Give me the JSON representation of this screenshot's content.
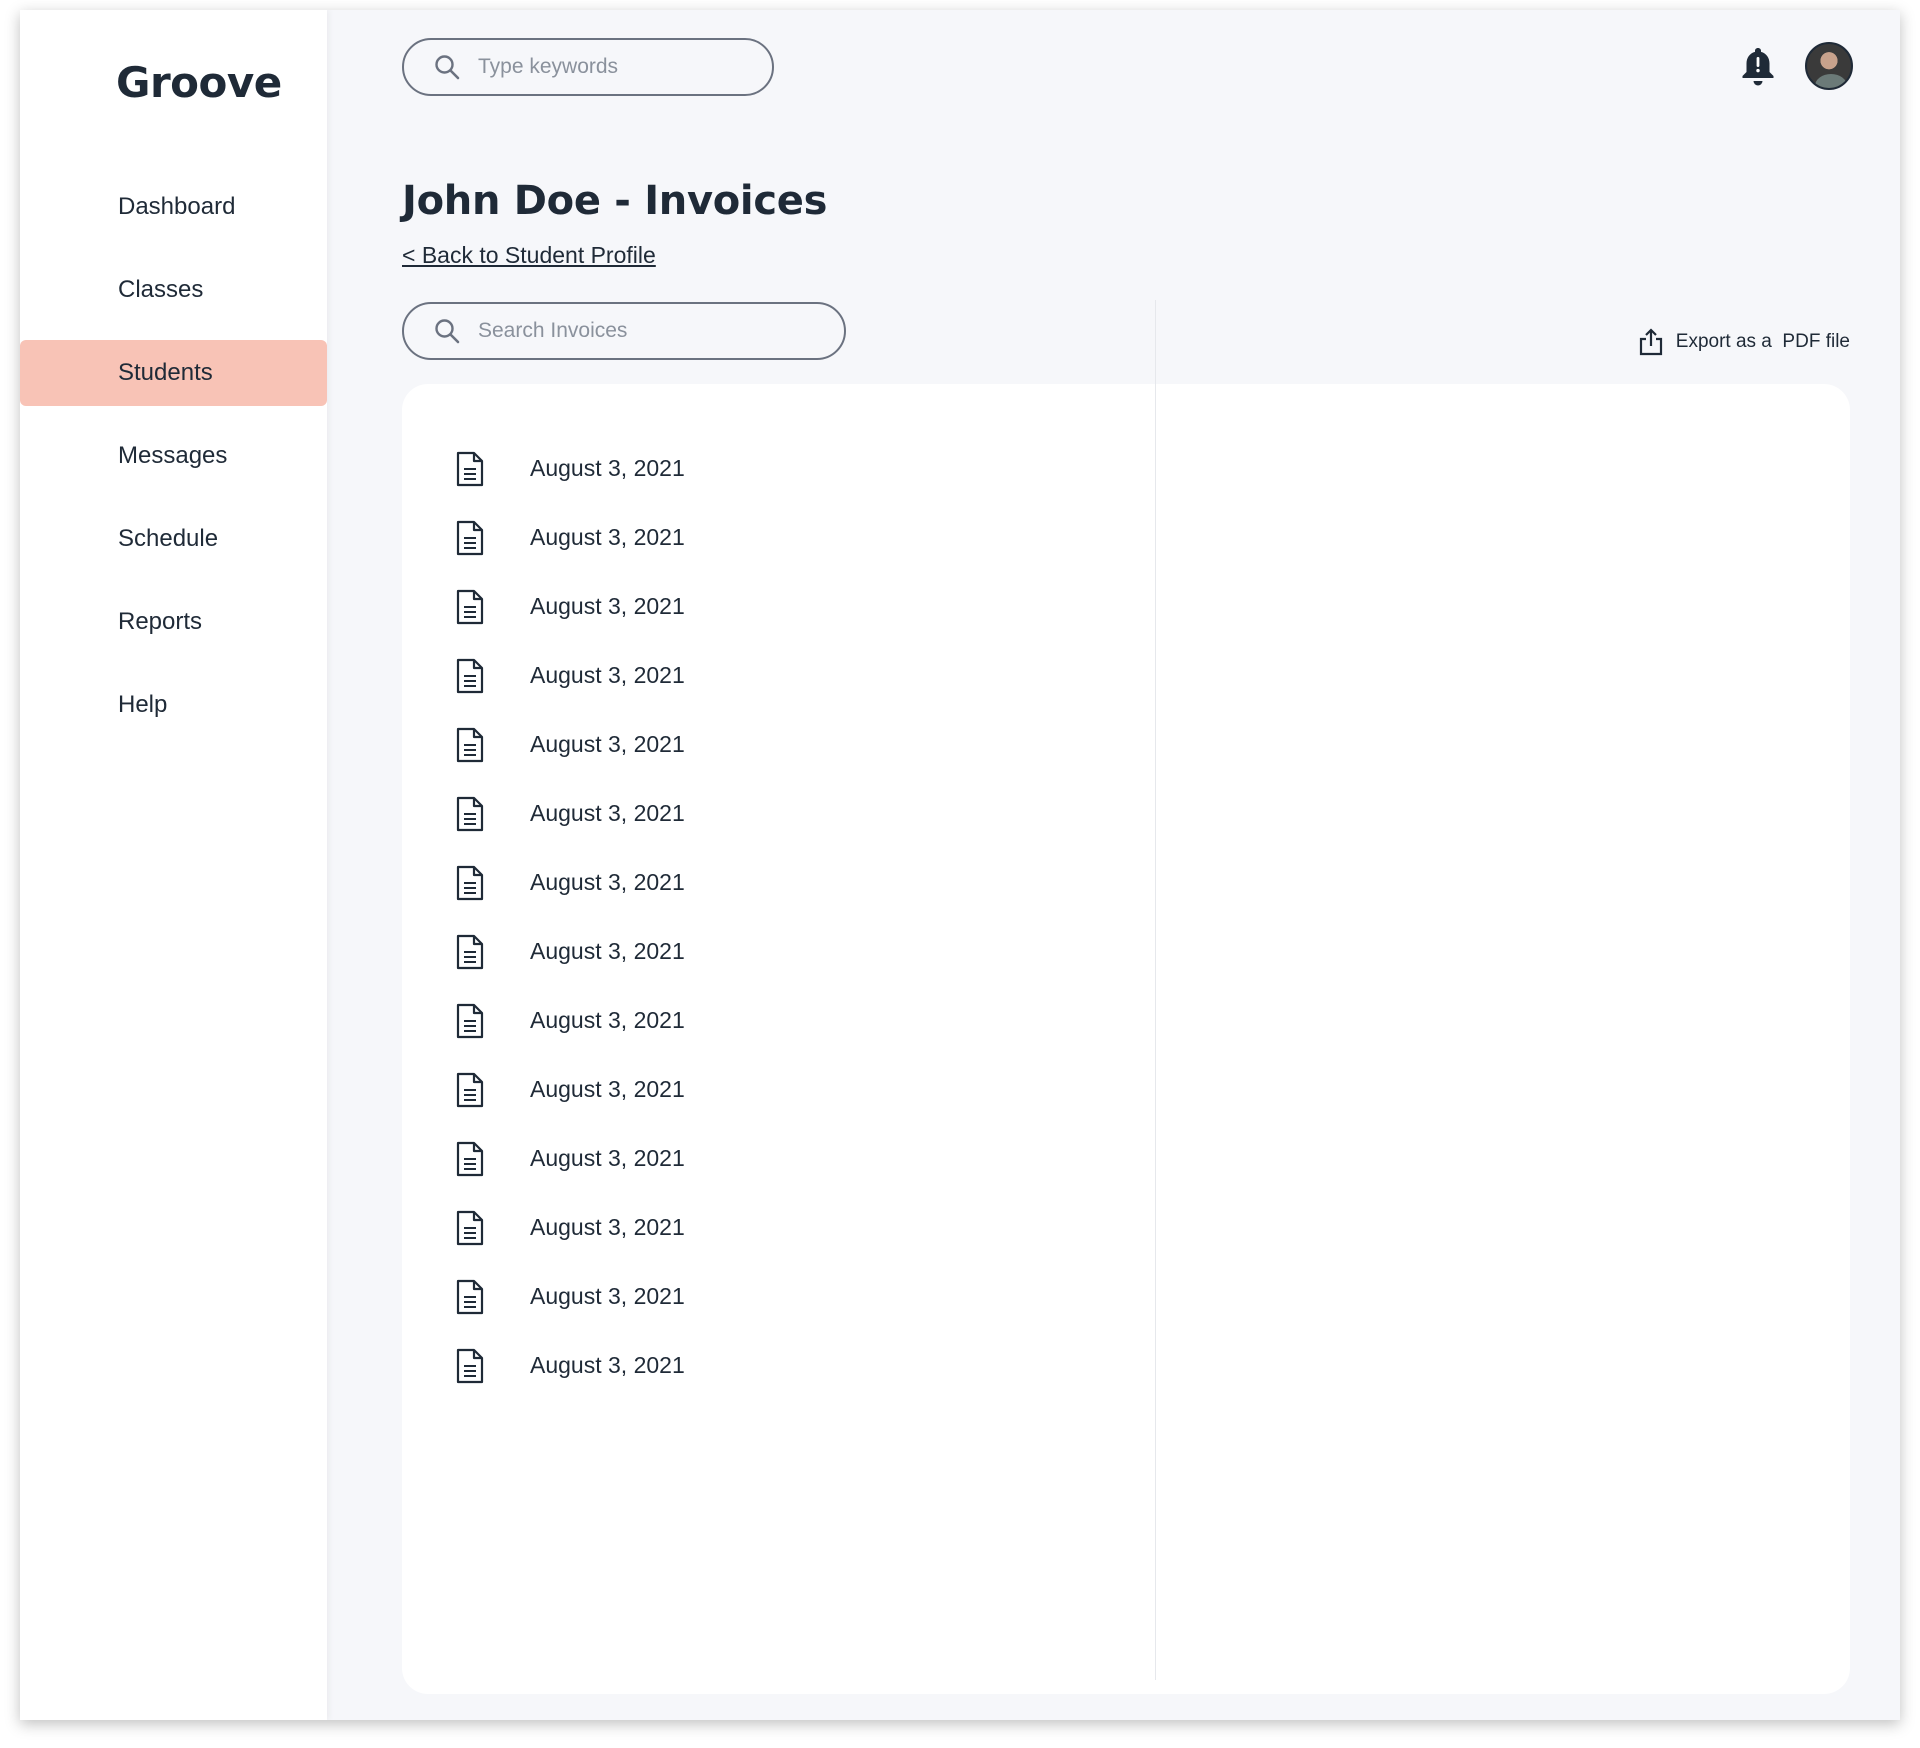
{
  "app": {
    "name": "Groove"
  },
  "sidebar": {
    "items": [
      {
        "label": "Dashboard",
        "active": false
      },
      {
        "label": "Classes",
        "active": false
      },
      {
        "label": "Students",
        "active": true
      },
      {
        "label": "Messages",
        "active": false
      },
      {
        "label": "Schedule",
        "active": false
      },
      {
        "label": "Reports",
        "active": false
      },
      {
        "label": "Help",
        "active": false
      }
    ],
    "active_color": "#f8c3b6"
  },
  "topbar": {
    "search_placeholder": "Type keywords",
    "icons": [
      "search-icon",
      "bell-alert-icon",
      "avatar"
    ]
  },
  "page": {
    "title": "John Doe - Invoices",
    "back_link": "< Back to Student Profile",
    "search_placeholder": "Search Invoices",
    "export_label": "Export as a  PDF file"
  },
  "invoices": [
    {
      "date": "August 3, 2021"
    },
    {
      "date": "August 3, 2021"
    },
    {
      "date": "August 3, 2021"
    },
    {
      "date": "August 3, 2021"
    },
    {
      "date": "August 3, 2021"
    },
    {
      "date": "August 3, 2021"
    },
    {
      "date": "August 3, 2021"
    },
    {
      "date": "August 3, 2021"
    },
    {
      "date": "August 3, 2021"
    },
    {
      "date": "August 3, 2021"
    },
    {
      "date": "August 3, 2021"
    },
    {
      "date": "August 3, 2021"
    },
    {
      "date": "August 3, 2021"
    },
    {
      "date": "August 3, 2021"
    }
  ],
  "colors": {
    "text": "#1f2a37",
    "background": "#f6f7fa",
    "panel": "#ffffff"
  }
}
